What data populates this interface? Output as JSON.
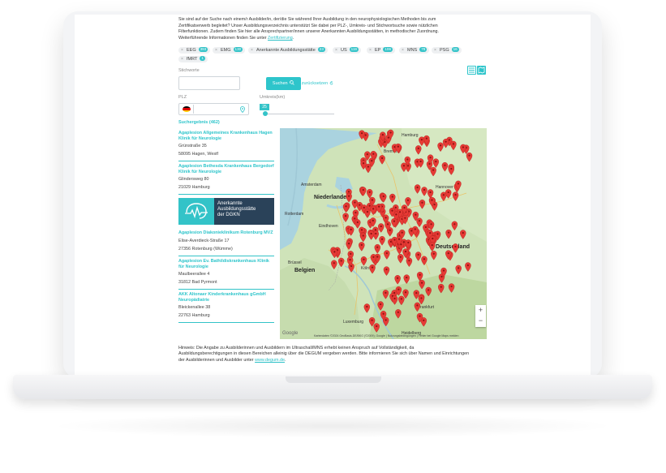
{
  "intro": {
    "line1": "Sie sind auf der Suche nach einem/r Ausbilder/in, der/die Sie während Ihrer Ausbildung in den neurophysiologischen Methoden bis zum",
    "line2": "Zertifikatserwerb begleitet? Unser Ausbildungsverzeichnis unterstützt Sie dabei per PLZ-, Umkreis- und Stichwortsuche sowie nützlichen",
    "line3": "Filterfunktionen. Zudem finden Sie hier alle Ansprechpartner/innen unserer Anerkannten Ausbildungsstätten, in methodischer Zuordnung.",
    "line4_prefix": "Weiterführende Informationen finden Sie unter",
    "line4_link": "Zertifizierung",
    "line4_suffix": "."
  },
  "tags": [
    {
      "label": "EEG",
      "count": "393"
    },
    {
      "label": "EMG",
      "count": "130"
    },
    {
      "label": "Anerkannte Ausbildungsstätte",
      "count": "23"
    },
    {
      "label": "US",
      "count": "119"
    },
    {
      "label": "EP",
      "count": "106"
    },
    {
      "label": "MNS",
      "count": "78"
    },
    {
      "label": "PSG",
      "count": "16"
    },
    {
      "label": "fMRT",
      "count": "1"
    }
  ],
  "search": {
    "keyword_label": "Stichworte",
    "keyword_value": "",
    "search_button": "Suchen",
    "search_icon": "search-icon",
    "reset_label": "Filter zurücksetzen",
    "reset_icon": "refresh-icon",
    "plz_label": "PLZ",
    "plz_value": "",
    "country_flag": "germany-flag",
    "location_icon": "map-pin-icon",
    "radius_label": "Umkreis(km)",
    "radius_value": "25",
    "radius_fraction": 0.05
  },
  "view_toggle": {
    "list_icon": "list-icon",
    "map_icon": "map-icon"
  },
  "results": {
    "count_label": "Suchergebnis (462)",
    "items": [
      {
        "title": "Agaplesion Allgemeines Krankenhaus Hagen Klinik für Neurologie",
        "street": "Grünstraße 35",
        "city": "58095 Hagen, Westf"
      },
      {
        "title": "Agaplesion Bethesda Krankenhaus Bergedorf Klinik für Neurologie",
        "street": "Glindersweg 80",
        "city": "21029 Hamburg"
      },
      {
        "title": "Agaplesion Diakonieklinikum Rotenburg MVZ",
        "street": "Elise-Averdieck-Straße 17",
        "city": "27356 Rotenburg (Wümme)"
      },
      {
        "title": "Agaplesion Ev. Bathildiskrankenhaus Klinik für Neurologie",
        "street": "Maulbeerallee 4",
        "city": "31812 Bad Pyrmont"
      },
      {
        "title": "AKK Altonaer Kinderkrankenhaus gGmbH Neuropädiatrie",
        "street": "Bleickenallee 38",
        "city": "22763 Hamburg"
      }
    ],
    "badge": {
      "line1": "Anerkannte",
      "line2": "Ausbildungsstätte",
      "line3": "der DGKN",
      "icon": "brain-wave-icon"
    }
  },
  "map": {
    "labels": {
      "niederlande": "Niederlande",
      "belgien": "Belgien",
      "deutschland": "Deutschland",
      "amsterdam": "Amsterdam",
      "rotterdam": "Rotterdam",
      "brussel": "Brüssel",
      "hamburg": "Hamburg",
      "hannover": "Hannover",
      "eindhoven": "Eindhoven",
      "koeln": "Köln",
      "frankfurt": "Frankfurt",
      "heidelberg": "Heidelberg",
      "bremen": "Bremen",
      "luxemburg": "Luxemburg"
    },
    "marker_icon": "map-marker-icon",
    "zoom_in": "+",
    "zoom_out": "−",
    "google_logo": "Google",
    "attribution": "Kartendaten ©2024 GeoBasis-DE/BKG (©2009), Google | Nutzungsbedingungen | Fehler bei Google Maps melden",
    "colors": {
      "water": "#aad3df",
      "land": "#cfe3b9",
      "marker": "#e63a35"
    }
  },
  "footnote": {
    "line1": "Hinweis: Die Angabe zu Ausbilderinnen und Ausbildern im Ultraschall/MNS erhebt keinen Anspruch auf Vollständigkeit, da",
    "line2": "Ausbildungsberechtigungen in diesen Bereichen alleinig über die DEGUM vergeben werden. Bitte informieren Sie sich über Namen und Einrichtungen",
    "line3_prefix": "der Ausbilderinnen und Ausbilder unter",
    "line3_link": "www.degum.de",
    "line3_suffix": "."
  },
  "colors": {
    "accent": "#2ec5cb",
    "badge_dark": "#2a4259"
  }
}
